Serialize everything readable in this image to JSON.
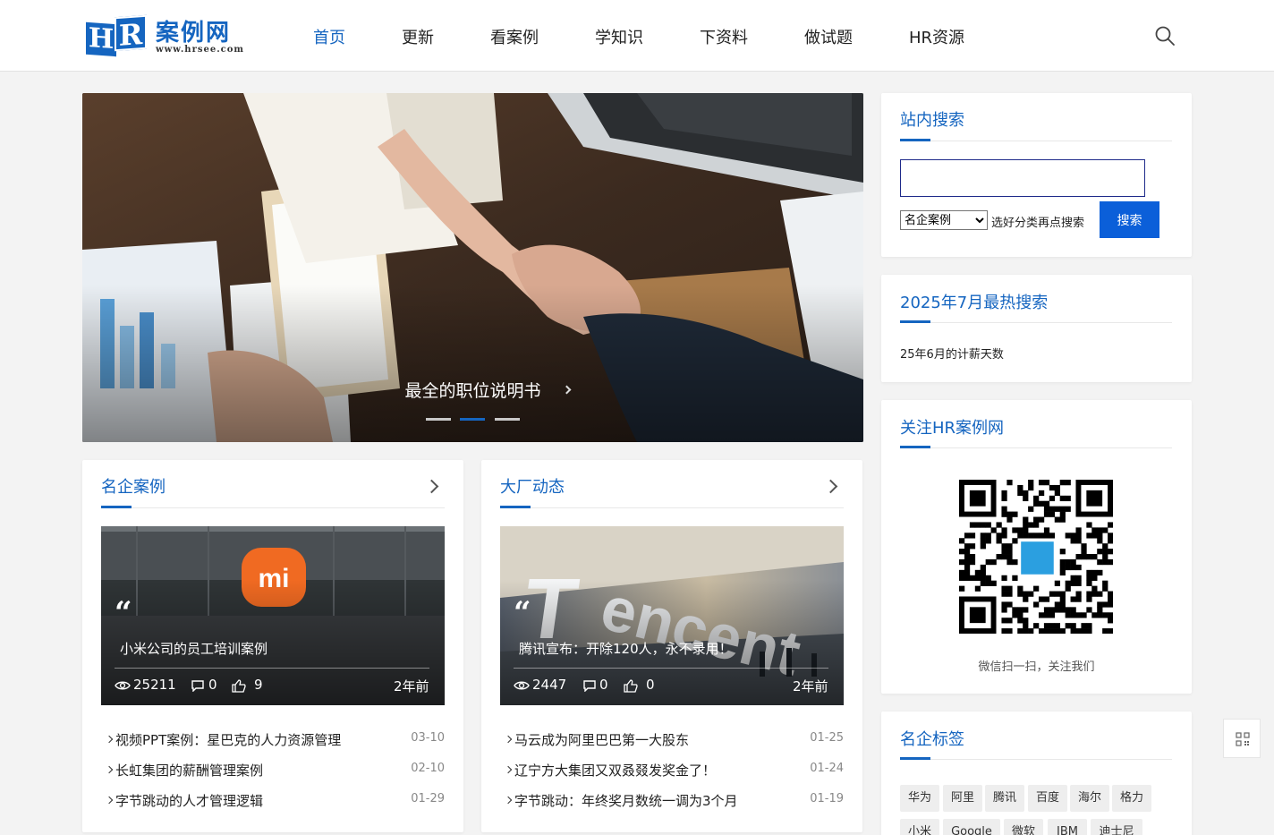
{
  "logo": {
    "mark_h": "H",
    "mark_r": "R",
    "name": "案例网",
    "url": "www.hrsee.com"
  },
  "nav": {
    "items": [
      "首页",
      "更新",
      "看案例",
      "学知识",
      "下资料",
      "做试题",
      "HR资源"
    ],
    "active_index": 0
  },
  "hero": {
    "caption": "最全的职位说明书",
    "slide_count": 3,
    "active_slide": 1
  },
  "sidebar": {
    "search": {
      "title": "站内搜索",
      "input_value": "",
      "select_value": "名企案例",
      "hint": "选好分类再点搜索",
      "button": "搜索"
    },
    "hot": {
      "title": "2025年7月最热搜索",
      "items": [
        "25年6月的计薪天数"
      ]
    },
    "follow": {
      "title": "关注HR案例网",
      "qr_caption": "微信扫一扫，关注我们"
    },
    "tags": {
      "title": "名企标签",
      "items": [
        "华为",
        "阿里",
        "腾讯",
        "百度",
        "海尔",
        "格力",
        "小米",
        "Google",
        "微软",
        "IBM",
        "迪士尼"
      ]
    }
  },
  "sections": [
    {
      "title": "名企案例",
      "featured": {
        "title": "小米公司的员工培训案例",
        "views": "25211",
        "comments": "0",
        "likes": "9",
        "time": "2年前"
      },
      "items": [
        {
          "title": "视频PPT案例：星巴克的人力资源管理",
          "date": "03-10"
        },
        {
          "title": "长虹集团的薪酬管理案例",
          "date": "02-10"
        },
        {
          "title": "字节跳动的人才管理逻辑",
          "date": "01-29"
        }
      ]
    },
    {
      "title": "大厂动态",
      "featured": {
        "title": "腾讯宣布：开除120人，永不录用！",
        "views": "2447",
        "comments": "0",
        "likes": "0",
        "time": "2年前"
      },
      "items": [
        {
          "title": "马云成为阿里巴巴第一大股东",
          "date": "01-25"
        },
        {
          "title": "辽宁方大集团又双叒叕发奖金了！",
          "date": "01-24"
        },
        {
          "title": "字节跳动：年终奖月数统一调为3个月",
          "date": "01-19"
        }
      ]
    }
  ],
  "colors": {
    "accent": "#1565c0",
    "button": "#0b5fd9",
    "page_bg": "#f3f3f3"
  },
  "icons": [
    "search-icon",
    "eye-icon",
    "comment-icon",
    "thumbs-up-icon",
    "chevron-right-icon",
    "qr-code-icon"
  ]
}
